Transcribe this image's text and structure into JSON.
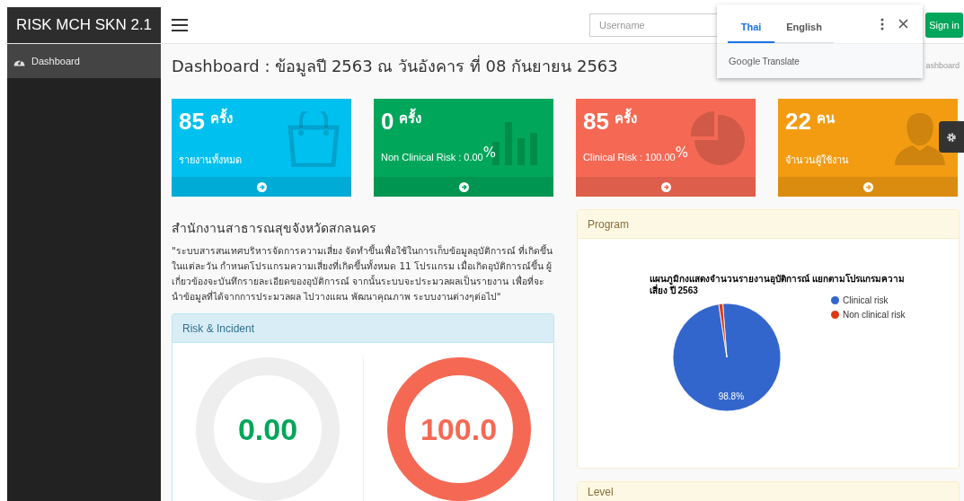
{
  "brand": "RISK MCH SKN 2.1",
  "sidebar": {
    "items": [
      {
        "label": "Dashboard",
        "selected": true
      }
    ]
  },
  "login": {
    "username_placeholder": "Username",
    "button": "Sign in"
  },
  "translate_popup": {
    "tabs": [
      {
        "label": "Thai",
        "selected": true
      },
      {
        "label": "English",
        "selected": false
      }
    ],
    "footer_brand": "Google",
    "footer_product": "Translate"
  },
  "page_title": "Dashboard : ข้อมูลปี 2563 ณ วันอังคาร ที่ 08 กันยายน 2563",
  "breadcrumb": "ashboard",
  "stats": [
    {
      "value": "85",
      "unit": "ครั้ง",
      "label": "รายงานทั้งหมด",
      "color": "#00c0ef"
    },
    {
      "value": "0",
      "unit": "ครั้ง",
      "label": "Non Clinical Risk : 0.00",
      "percent": "%",
      "color": "#00a65a"
    },
    {
      "value": "85",
      "unit": "ครั้ง",
      "label": "Clinical Risk : 100.00",
      "percent": "%",
      "color": "#f56954"
    },
    {
      "value": "22",
      "unit": "คน",
      "label": "จำนวนผู้ใช้งาน",
      "color": "#f39c12"
    }
  ],
  "org": {
    "title": "สำนักงานสาธารณสุขจังหวัดสกลนคร",
    "description": "\"ระบบสารสนเทศบริหารจัดการความเสี่ยง จัดทำขึ้นเพื่อใช้ในการเก็บข้อมูลอุบัติการณ์ ที่เกิดขึ้นในแต่ละวัน กำหนดโปรแกรมความเสี่ยงที่เกิดขึ้นทั้งหมด 11 โปรแกรม เมื่อเกิดอุบัติการณ์ขึ้น ผู้เกี่ยวข้องจะบันทึกรายละเอียดของอุบัติการณ์ จากนั้นระบบจะประมวลผลเป็นรายงาน เพื่อที่จะนำข้อมูลที่ได้จากการประมวลผล ไปวางแผน พัฒนาคุณภาพ ระบบงานต่างๆต่อไป\""
  },
  "risk_panel": {
    "title": "Risk & Incident",
    "gauges": [
      {
        "value": "0.00",
        "level": 0,
        "color": "#00a65a"
      },
      {
        "value": "100.0",
        "level": 1,
        "color": "#f56954"
      }
    ]
  },
  "program_panel": {
    "title": "Program",
    "chart_data": {
      "type": "pie",
      "title": "แผนภูมิกงแสดงจำนวนรายงานอุบัติการณ์ แยกตามโปรแกรมความเสี่ยง ปี 2563",
      "categories": [
        "Clinical risk",
        "Non clinical risk"
      ],
      "series": [
        {
          "colors": [
            "#3366cc",
            "#dc3912"
          ],
          "values": [
            98.8,
            1.2
          ]
        }
      ],
      "value_labels": [
        "98.8%",
        null
      ],
      "legend": "right"
    }
  },
  "level_panel": {
    "title": "Level"
  }
}
